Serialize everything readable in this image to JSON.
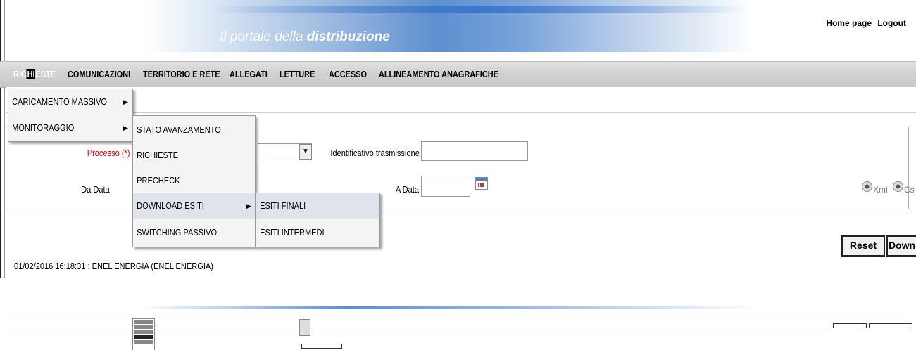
{
  "header": {
    "portal_title_prefix": "Il portale della ",
    "portal_title_bold": "distribuzione",
    "home_link": "Home page",
    "logout_link": "Logout"
  },
  "menubar": {
    "items": [
      {
        "label": "RICHIESTE"
      },
      {
        "label": "COMUNICAZIONI"
      },
      {
        "label": "TERRITORIO E RETE"
      },
      {
        "label": "ALLEGATI"
      },
      {
        "label": "LETTURE"
      },
      {
        "label": "ACCESSO"
      },
      {
        "label": "ALLINEAMENTO ANAGRAFICHE"
      }
    ],
    "active_prefix": "RIC",
    "active_highlight": "HI",
    "active_suffix": "ESTE"
  },
  "dropdown_level1": [
    {
      "label": "CARICAMENTO MASSIVO"
    },
    {
      "label": "MONITORAGGIO"
    }
  ],
  "dropdown_level2": [
    {
      "label": "STATO AVANZAMENTO"
    },
    {
      "label": "RICHIESTE"
    },
    {
      "label": "PRECHECK"
    },
    {
      "label": "DOWNLOAD ESITI"
    },
    {
      "label": "SWITCHING PASSIVO"
    }
  ],
  "dropdown_level3": [
    {
      "label": "ESITI FINALI"
    },
    {
      "label": "ESITI INTERMEDI"
    }
  ],
  "form": {
    "processo_label": "Processo (*)",
    "da_data_label": "Da Data",
    "identificativo_label": "Identificativo trasmissione",
    "identificativo_value": "",
    "a_data_label": "A Data",
    "a_data_value": "",
    "format_xml": "Xml",
    "format_csv": "Cs"
  },
  "buttons": {
    "reset": "Reset",
    "download": "Down"
  },
  "status_line": "01/02/2016 16:18:31  :  ENEL ENERGIA   (ENEL ENERGIA)",
  "colors": {
    "banner_blue": "#5d8fd0",
    "required_label": "#d40000",
    "selected_menu": "#dfe3ec"
  }
}
